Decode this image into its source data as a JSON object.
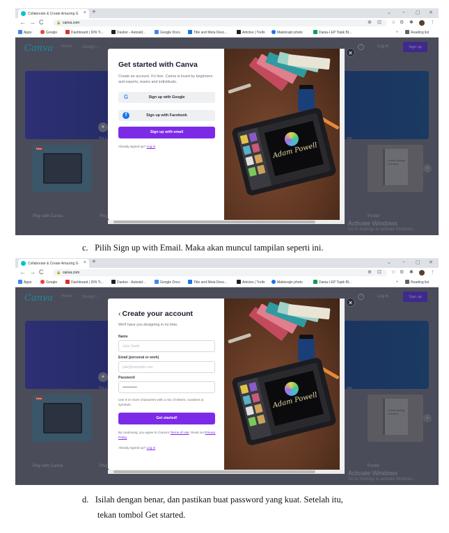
{
  "browser": {
    "tab_title": "Collaborate & Create Amazing G",
    "tab_close": "×",
    "new_tab": "+",
    "url": "canva.com",
    "window_controls": [
      "⌄",
      "–",
      "▢",
      "✕"
    ],
    "bookmarks": [
      "Apps",
      "Google",
      "Dashboard | IDN Ti...",
      "Dasbor - Autosid...",
      "Google Docs",
      "Title and Meta Desc...",
      "Articles | Trello",
      "Makinrajin photo",
      "Dania-I EP Topik Bl..."
    ],
    "reading_list": "Reading list",
    "bookmark_more": "»"
  },
  "canva_bg": {
    "logo": "Canva",
    "nav": [
      "Home",
      "Design ⌄"
    ],
    "login": "Log in",
    "signup": "Sign up",
    "help": "?",
    "hero_for": "For y",
    "hero_right": "ore",
    "card1_tag": "New",
    "card1_caption": "Play with Canva",
    "card2_caption": "Pho",
    "card3_caption": "Poster",
    "card3_book": "Virtual Selling Success",
    "next": "›",
    "activate_title": "Activate Windows",
    "activate_sub": "Go to Settings to activate Windows."
  },
  "modal1": {
    "title": "Get started with Canva",
    "subtitle": "Create an account. It's free. Canva is loved by beginners and experts, teams and individuals.",
    "google_btn": "Sign up with Google",
    "facebook_btn": "Sign up with Facebook",
    "email_btn": "Sign up with email",
    "already": "Already signed up?",
    "login_link": "Log in",
    "close": "✕"
  },
  "modal2": {
    "back": "‹",
    "title": "Create your account",
    "subtitle": "We'll have you designing in no time.",
    "name_label": "Name",
    "name_placeholder": "Julie Smith",
    "email_label": "Email (personal or work)",
    "email_placeholder": "julie@example.com",
    "password_label": "Password",
    "password_value": "••••••••••••",
    "password_hint": "Use 8 or more characters with a mix of letters, numbers & symbols.",
    "submit": "Get started!",
    "terms_pre": "By continuing, you agree to Canva's",
    "terms_link": "Terms of Use",
    "terms_mid": ". Read our",
    "privacy_link": "Privacy Policy",
    "already": "Already signed up?",
    "login_link": "Log in",
    "close": "✕"
  },
  "art": {
    "signature": "Adam Powell"
  },
  "captions": {
    "c_letter": "c.",
    "c_text": "Pilih Sign up with Email. Maka akan muncul tampilan seperti ini.",
    "d_letter": "d.",
    "d_line1": "Isilah dengan benar, dan pastikan buat password yang kuat. Setelah itu,",
    "d_line2": "tekan tombol Get started."
  },
  "colors": {
    "canva_purple": "#7d2ae8",
    "facebook_blue": "#1877f2",
    "google_blue": "#4285f4"
  }
}
